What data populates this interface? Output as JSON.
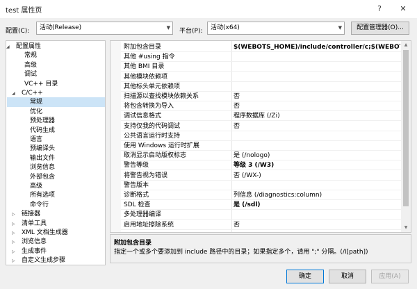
{
  "window": {
    "title": "test 属性页",
    "help_glyph": "?",
    "close_glyph": "✕"
  },
  "config_bar": {
    "config_label": "配置(C):",
    "config_value": "活动(Release)",
    "platform_label": "平台(P):",
    "platform_value": "活动(x64)",
    "manager_button": "配置管理器(O)..."
  },
  "tree": {
    "items": [
      {
        "label": "配置属性",
        "expander": "◢"
      },
      {
        "label": "常规"
      },
      {
        "label": "高级"
      },
      {
        "label": "调试"
      },
      {
        "label": "VC++ 目录"
      },
      {
        "label": "C/C++",
        "expander": "◢"
      },
      {
        "label": "常规",
        "selected": true
      },
      {
        "label": "优化"
      },
      {
        "label": "预处理器"
      },
      {
        "label": "代码生成"
      },
      {
        "label": "语言"
      },
      {
        "label": "预编译头"
      },
      {
        "label": "输出文件"
      },
      {
        "label": "浏览信息"
      },
      {
        "label": "外部包含"
      },
      {
        "label": "高级"
      },
      {
        "label": "所有选项"
      },
      {
        "label": "命令行"
      },
      {
        "label": "链接器",
        "expander": "▷"
      },
      {
        "label": "清单工具",
        "expander": "▷"
      },
      {
        "label": "XML 文档生成器",
        "expander": "▷"
      },
      {
        "label": "浏览信息",
        "expander": "▷"
      },
      {
        "label": "生成事件",
        "expander": "▷"
      },
      {
        "label": "自定义生成步骤",
        "expander": "▷"
      }
    ]
  },
  "properties": {
    "rows": [
      {
        "name": "附加包含目录",
        "value": "$(WEBOTS_HOME)/include/controller/c;$(WEBOTS_H",
        "bold": true
      },
      {
        "name": "其他 #using 指令",
        "value": ""
      },
      {
        "name": "其他 BMI 目录",
        "value": ""
      },
      {
        "name": "其他模块依赖项",
        "value": ""
      },
      {
        "name": "其他标头单元依赖项",
        "value": ""
      },
      {
        "name": "扫描源以查找模块依赖关系",
        "value": "否"
      },
      {
        "name": "将包含转换为导入",
        "value": "否"
      },
      {
        "name": "调试信息格式",
        "value": "程序数据库 (/Zi)"
      },
      {
        "name": "支持仅我的代码调试",
        "value": "否"
      },
      {
        "name": "公共语言运行时支持",
        "value": ""
      },
      {
        "name": "使用 Windows 运行时扩展",
        "value": ""
      },
      {
        "name": "取消显示启动版权标志",
        "value": "是 (/nologo)"
      },
      {
        "name": "警告等级",
        "value": "等级 3 (/W3)",
        "bold": true
      },
      {
        "name": "将警告视为错误",
        "value": "否 (/WX-)"
      },
      {
        "name": "警告版本",
        "value": ""
      },
      {
        "name": "诊断格式",
        "value": "列信息 (/diagnostics:column)"
      },
      {
        "name": "SDL 检查",
        "value": "是 (/sdl)",
        "bold": true
      },
      {
        "name": "多处理器编译",
        "value": ""
      },
      {
        "name": "启用地址擦除系统",
        "value": "否"
      }
    ]
  },
  "description": {
    "title": "附加包含目录",
    "text": "指定一个或多个要添加到 include 路径中的目录；如果指定多个，请用 \";\" 分隔。(/I[path])"
  },
  "buttons": {
    "ok": "确定",
    "cancel": "取消",
    "apply": "应用(A)"
  }
}
